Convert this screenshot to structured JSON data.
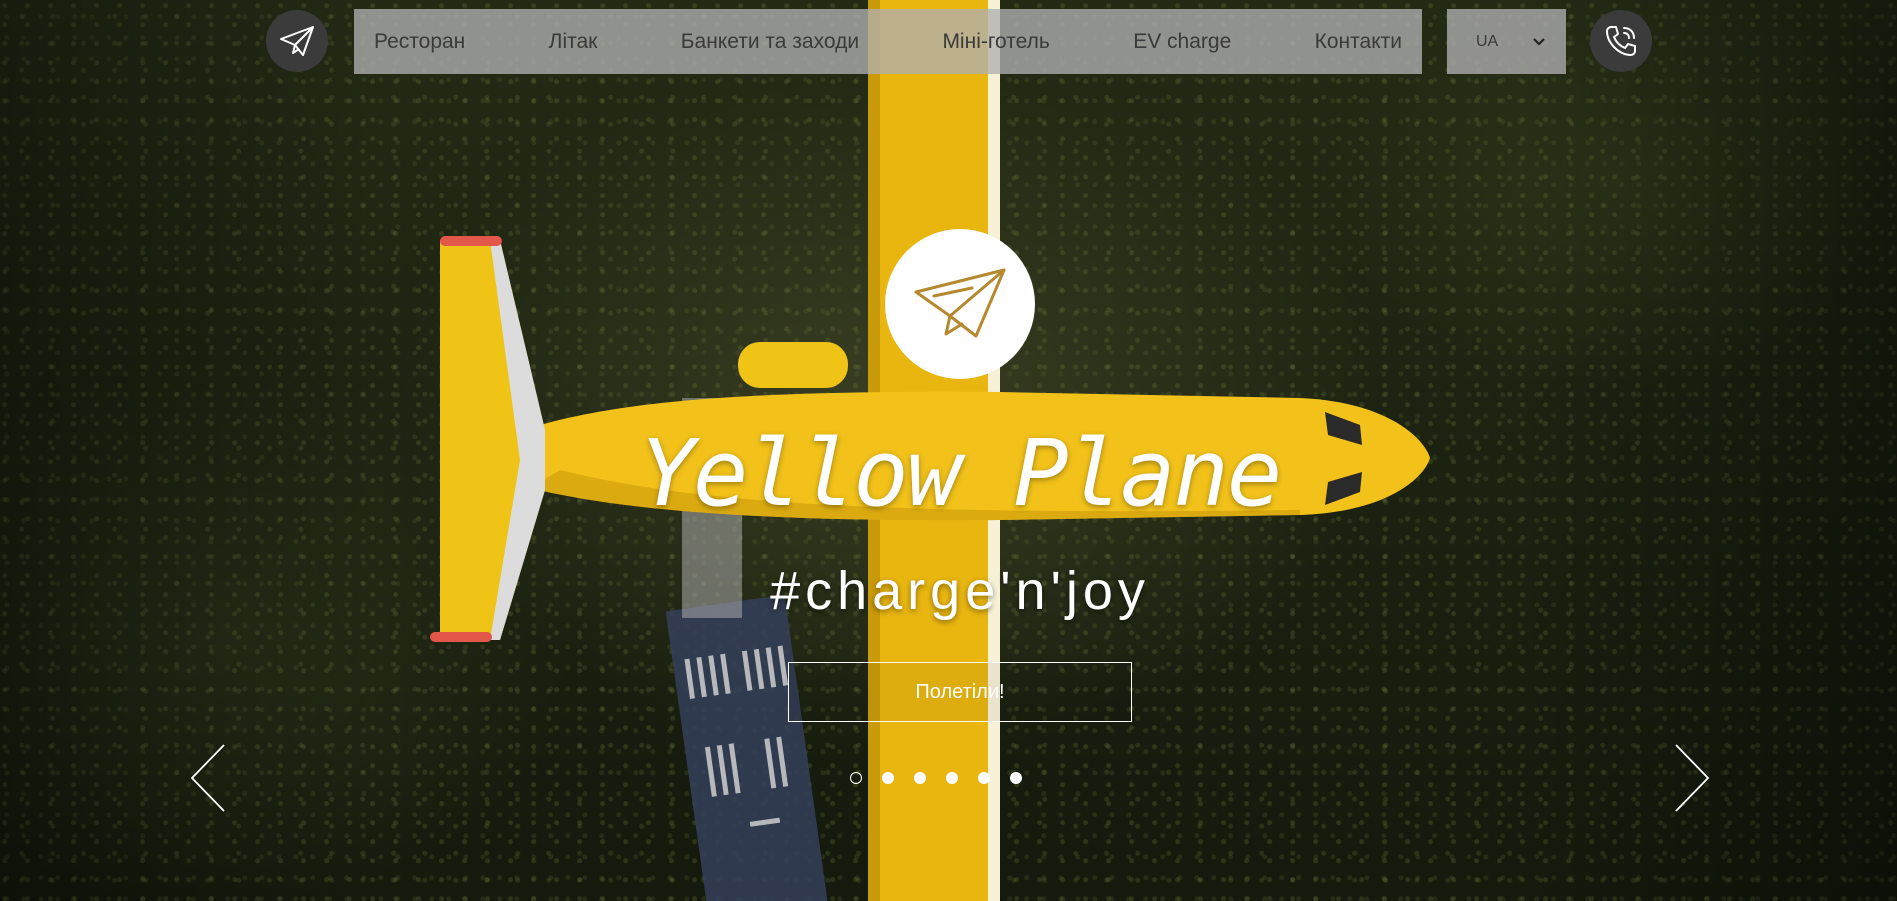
{
  "nav": {
    "items": [
      {
        "label": "Ресторан"
      },
      {
        "label": "Літак"
      },
      {
        "label": "Банкети та заходи"
      },
      {
        "label": "Міні-готель"
      },
      {
        "label": "EV charge"
      },
      {
        "label": "Контакти"
      }
    ],
    "language": {
      "selected": "UA"
    }
  },
  "hero": {
    "title": "Yellow Plane",
    "tagline": "#charge'n'joy",
    "cta_label": "Полетіли!"
  },
  "slider": {
    "slide_count": 6,
    "active_slide": 1
  },
  "icons": {
    "logo": "paper-plane-icon",
    "phone": "phone-icon",
    "dropdown": "chevron-down-icon",
    "prev": "chevron-left-icon",
    "next": "chevron-right-icon"
  },
  "colors": {
    "plane_yellow": "#f2c21a",
    "nav_bg": "#afafaf",
    "icon_circle": "#3b3b3b",
    "accent_brown": "#b5892e",
    "text_white": "#ffffff"
  }
}
